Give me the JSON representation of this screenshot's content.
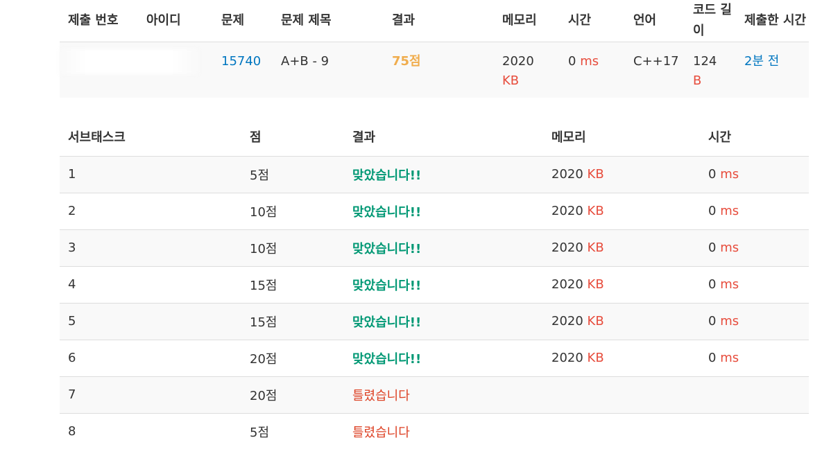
{
  "submission": {
    "headers": {
      "id": "제출 번호",
      "user": "아이디",
      "problem": "문제",
      "title": "문제 제목",
      "result": "결과",
      "memory": "메모리",
      "time": "시간",
      "lang": "언어",
      "code_length": "코드 길이",
      "submitted_at": "제출한 시간"
    },
    "row": {
      "problem_id": "15740",
      "title": "A+B - 9",
      "result": "75점",
      "memory_value": "2020",
      "memory_unit": "KB",
      "time_value": "0",
      "time_unit": "ms",
      "lang": "C++17",
      "code_length_value": "124",
      "code_length_unit": "B",
      "submitted_at": "2분 전"
    }
  },
  "subtasks": {
    "headers": {
      "subtask": "서브태스크",
      "score": "점",
      "result": "결과",
      "memory": "메모리",
      "time": "시간"
    },
    "rows": [
      {
        "n": "1",
        "score": "5점",
        "result": "맞았습니다!!",
        "memory": "2020",
        "memory_unit": "KB",
        "time": "0",
        "time_unit": "ms"
      },
      {
        "n": "2",
        "score": "10점",
        "result": "맞았습니다!!",
        "memory": "2020",
        "memory_unit": "KB",
        "time": "0",
        "time_unit": "ms"
      },
      {
        "n": "3",
        "score": "10점",
        "result": "맞았습니다!!",
        "memory": "2020",
        "memory_unit": "KB",
        "time": "0",
        "time_unit": "ms"
      },
      {
        "n": "4",
        "score": "15점",
        "result": "맞았습니다!!",
        "memory": "2020",
        "memory_unit": "KB",
        "time": "0",
        "time_unit": "ms"
      },
      {
        "n": "5",
        "score": "15점",
        "result": "맞았습니다!!",
        "memory": "2020",
        "memory_unit": "KB",
        "time": "0",
        "time_unit": "ms"
      },
      {
        "n": "6",
        "score": "20점",
        "result": "맞았습니다!!",
        "memory": "2020",
        "memory_unit": "KB",
        "time": "0",
        "time_unit": "ms"
      },
      {
        "n": "7",
        "score": "20점",
        "result": "틀렸습니다"
      },
      {
        "n": "8",
        "score": "5점",
        "result": "틀렸습니다"
      }
    ]
  },
  "colors": {
    "accepted": "#009874",
    "wrong": "#dd4124",
    "partial_score": "#f0ad4e",
    "link": "#0076c0",
    "unit": "#e74c3c"
  }
}
